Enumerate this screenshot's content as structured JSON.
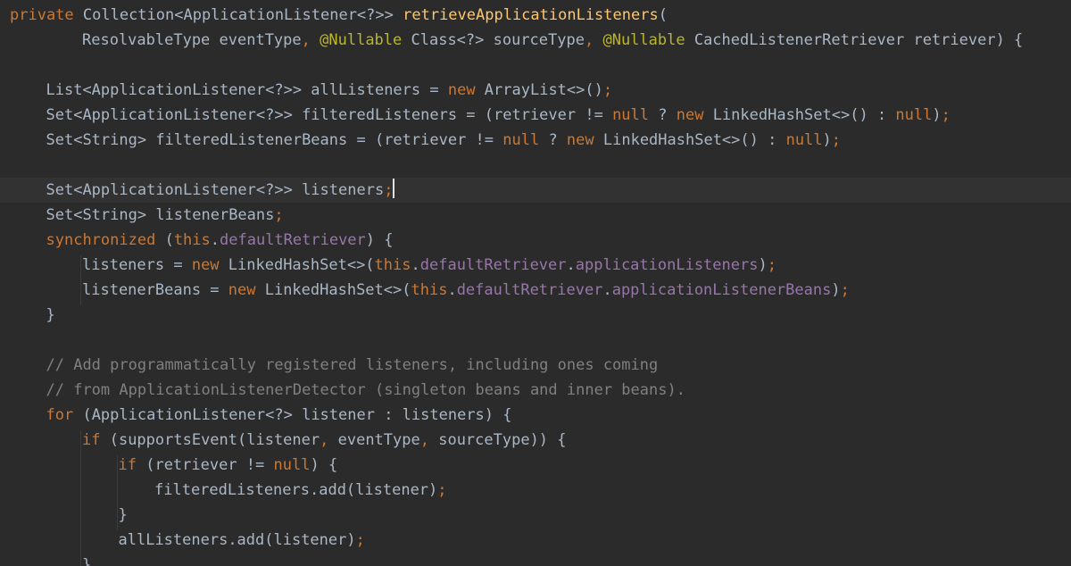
{
  "editor": {
    "language": "java",
    "theme": "darcula",
    "colors": {
      "background": "#2b2b2b",
      "current_line": "#323232",
      "plain": "#a9b7c6",
      "keyword": "#cc7832",
      "method": "#ffc66d",
      "annotation": "#bbb529",
      "field": "#9876aa",
      "comment": "#808080"
    },
    "lines": [
      {
        "indent": 0,
        "tokens": [
          {
            "t": "private",
            "c": "kw"
          },
          {
            "t": " Collection<ApplicationListener<?>> ",
            "c": "p"
          },
          {
            "t": "retrieveApplicationListeners",
            "c": "fn"
          },
          {
            "t": "(",
            "c": "p"
          }
        ]
      },
      {
        "indent": 2,
        "tokens": [
          {
            "t": "ResolvableType eventType",
            "c": "p"
          },
          {
            "t": ",",
            "c": "kw"
          },
          {
            "t": " ",
            "c": "p"
          },
          {
            "t": "@Nullable",
            "c": "ann"
          },
          {
            "t": " Class<?> sourceType",
            "c": "p"
          },
          {
            "t": ",",
            "c": "kw"
          },
          {
            "t": " ",
            "c": "p"
          },
          {
            "t": "@Nullable",
            "c": "ann"
          },
          {
            "t": " CachedListenerRetriever retriever) {",
            "c": "p"
          }
        ]
      },
      {
        "indent": 0,
        "tokens": []
      },
      {
        "indent": 1,
        "tokens": [
          {
            "t": "List<ApplicationListener<?>> allListeners = ",
            "c": "p"
          },
          {
            "t": "new",
            "c": "kw"
          },
          {
            "t": " ArrayList<>()",
            "c": "p"
          },
          {
            "t": ";",
            "c": "kw"
          }
        ]
      },
      {
        "indent": 1,
        "tokens": [
          {
            "t": "Set<ApplicationListener<?>> filteredListeners = (retriever != ",
            "c": "p"
          },
          {
            "t": "null",
            "c": "kw"
          },
          {
            "t": " ? ",
            "c": "p"
          },
          {
            "t": "new",
            "c": "kw"
          },
          {
            "t": " LinkedHashSet<>() : ",
            "c": "p"
          },
          {
            "t": "null",
            "c": "kw"
          },
          {
            "t": ")",
            "c": "p"
          },
          {
            "t": ";",
            "c": "kw"
          }
        ]
      },
      {
        "indent": 1,
        "tokens": [
          {
            "t": "Set<String> filteredListenerBeans = (retriever != ",
            "c": "p"
          },
          {
            "t": "null",
            "c": "kw"
          },
          {
            "t": " ? ",
            "c": "p"
          },
          {
            "t": "new",
            "c": "kw"
          },
          {
            "t": " LinkedHashSet<>() : ",
            "c": "p"
          },
          {
            "t": "null",
            "c": "kw"
          },
          {
            "t": ")",
            "c": "p"
          },
          {
            "t": ";",
            "c": "kw"
          }
        ]
      },
      {
        "indent": 0,
        "tokens": []
      },
      {
        "indent": 1,
        "current": true,
        "tokens": [
          {
            "t": "Set<ApplicationListener<?>> listeners",
            "c": "p"
          },
          {
            "t": ";",
            "c": "kw"
          }
        ]
      },
      {
        "indent": 1,
        "tokens": [
          {
            "t": "Set<String> listenerBeans",
            "c": "p"
          },
          {
            "t": ";",
            "c": "kw"
          }
        ]
      },
      {
        "indent": 1,
        "tokens": [
          {
            "t": "synchronized",
            "c": "kw"
          },
          {
            "t": " (",
            "c": "p"
          },
          {
            "t": "this",
            "c": "kw"
          },
          {
            "t": ".",
            "c": "p"
          },
          {
            "t": "defaultRetriever",
            "c": "field"
          },
          {
            "t": ") {",
            "c": "p"
          }
        ]
      },
      {
        "indent": 2,
        "tokens": [
          {
            "t": "listeners = ",
            "c": "p"
          },
          {
            "t": "new",
            "c": "kw"
          },
          {
            "t": " LinkedHashSet<>(",
            "c": "p"
          },
          {
            "t": "this",
            "c": "kw"
          },
          {
            "t": ".",
            "c": "p"
          },
          {
            "t": "defaultRetriever",
            "c": "field"
          },
          {
            "t": ".",
            "c": "p"
          },
          {
            "t": "applicationListeners",
            "c": "field"
          },
          {
            "t": ")",
            "c": "p"
          },
          {
            "t": ";",
            "c": "kw"
          }
        ]
      },
      {
        "indent": 2,
        "tokens": [
          {
            "t": "listenerBeans = ",
            "c": "p"
          },
          {
            "t": "new",
            "c": "kw"
          },
          {
            "t": " LinkedHashSet<>(",
            "c": "p"
          },
          {
            "t": "this",
            "c": "kw"
          },
          {
            "t": ".",
            "c": "p"
          },
          {
            "t": "defaultRetriever",
            "c": "field"
          },
          {
            "t": ".",
            "c": "p"
          },
          {
            "t": "applicationListenerBeans",
            "c": "field"
          },
          {
            "t": ")",
            "c": "p"
          },
          {
            "t": ";",
            "c": "kw"
          }
        ]
      },
      {
        "indent": 1,
        "tokens": [
          {
            "t": "}",
            "c": "p"
          }
        ]
      },
      {
        "indent": 0,
        "tokens": []
      },
      {
        "indent": 1,
        "tokens": [
          {
            "t": "// Add programmatically registered listeners, including ones coming",
            "c": "cm"
          }
        ]
      },
      {
        "indent": 1,
        "tokens": [
          {
            "t": "// from ApplicationListenerDetector (singleton beans and inner beans).",
            "c": "cm"
          }
        ]
      },
      {
        "indent": 1,
        "tokens": [
          {
            "t": "for",
            "c": "kw"
          },
          {
            "t": " (ApplicationListener<?> listener : listeners) {",
            "c": "p"
          }
        ]
      },
      {
        "indent": 2,
        "tokens": [
          {
            "t": "if",
            "c": "kw"
          },
          {
            "t": " (supportsEvent(listener",
            "c": "p"
          },
          {
            "t": ",",
            "c": "kw"
          },
          {
            "t": " eventType",
            "c": "p"
          },
          {
            "t": ",",
            "c": "kw"
          },
          {
            "t": " sourceType)) {",
            "c": "p"
          }
        ]
      },
      {
        "indent": 3,
        "tokens": [
          {
            "t": "if",
            "c": "kw"
          },
          {
            "t": " (retriever != ",
            "c": "p"
          },
          {
            "t": "null",
            "c": "kw"
          },
          {
            "t": ") {",
            "c": "p"
          }
        ]
      },
      {
        "indent": 4,
        "tokens": [
          {
            "t": "filteredListeners.add(listener)",
            "c": "p"
          },
          {
            "t": ";",
            "c": "kw"
          }
        ]
      },
      {
        "indent": 3,
        "tokens": [
          {
            "t": "}",
            "c": "p"
          }
        ]
      },
      {
        "indent": 3,
        "tokens": [
          {
            "t": "allListeners.add(listener)",
            "c": "p"
          },
          {
            "t": ";",
            "c": "kw"
          }
        ]
      },
      {
        "indent": 2,
        "tokens": [
          {
            "t": "}",
            "c": "p"
          }
        ]
      }
    ]
  }
}
